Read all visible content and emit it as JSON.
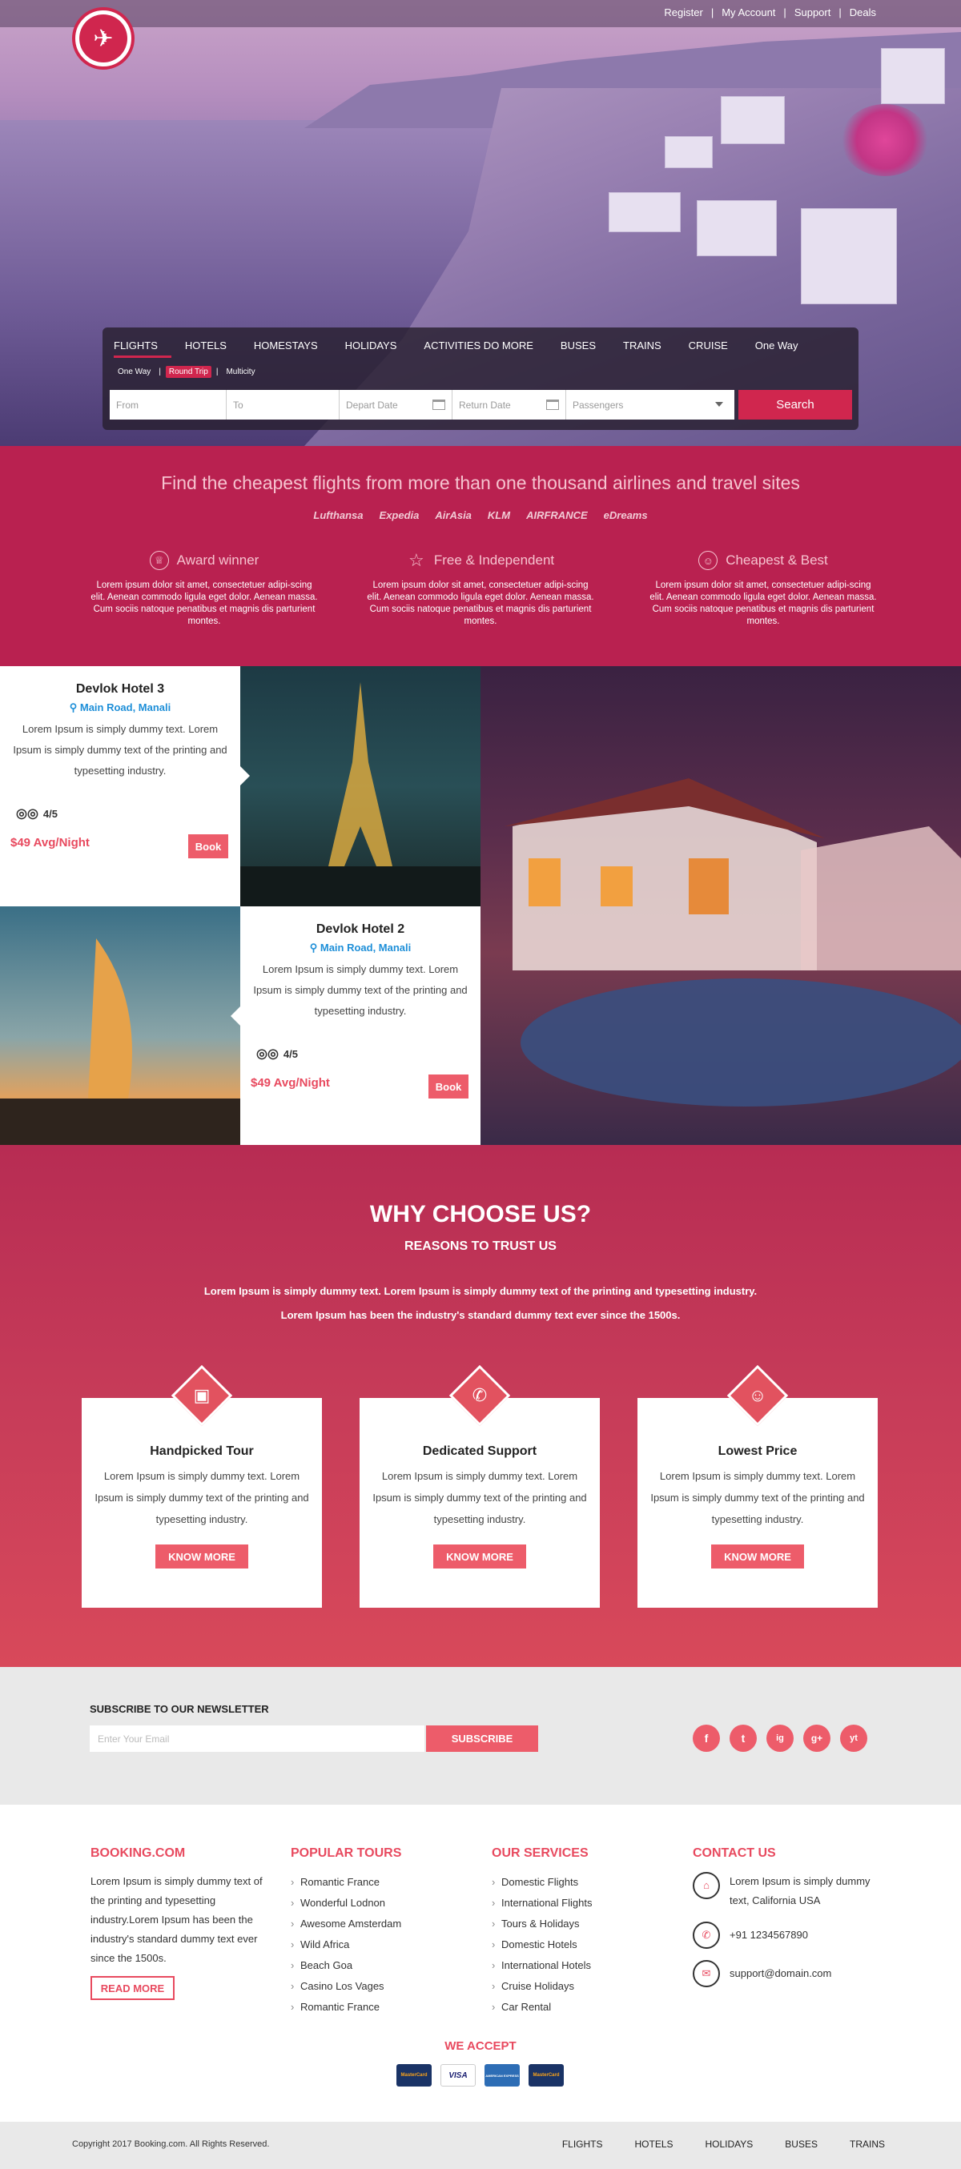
{
  "top_nav": [
    "Register",
    "My Account",
    "Support",
    "Deals"
  ],
  "search": {
    "tabs": [
      "FLIGHTS",
      "HOTELS",
      "HOMESTAYS",
      "HOLIDAYS",
      "ACTIVITIES DO MORE",
      "BUSES",
      "TRAINS",
      "CRUISE",
      "One Way"
    ],
    "trip_types": [
      "One Way",
      "Round Trip",
      "Multicity"
    ],
    "from_placeholder": "From",
    "to_placeholder": "To",
    "depart_placeholder": "Depart Date",
    "return_placeholder": "Return Date",
    "passengers_placeholder": "Passengers",
    "search_label": "Search"
  },
  "intro": {
    "title": "Find the cheapest flights from more than one thousand airlines and travel sites",
    "airlines": [
      "Lufthansa",
      "Expedia",
      "AirAsia",
      "KLM",
      "AIRFRANCE",
      "eDreams"
    ],
    "features": [
      {
        "title": "Award winner",
        "icon": "award-icon",
        "text": "Lorem ipsum dolor sit amet, consectetuer adipi-scing elit. Aenean commodo ligula eget dolor. Aenean massa. Cum sociis natoque penatibus et magnis dis parturient montes."
      },
      {
        "title": "Free & Independent",
        "icon": "star-icon",
        "text": "Lorem ipsum dolor sit amet, consectetuer adipi-scing elit. Aenean commodo ligula eget dolor. Aenean massa. Cum sociis natoque penatibus et magnis dis parturient montes."
      },
      {
        "title": "Cheapest & Best",
        "icon": "smile-icon",
        "text": "Lorem ipsum dolor sit amet, consectetuer adipi-scing elit. Aenean commodo ligula eget dolor. Aenean massa. Cum sociis natoque penatibus et magnis dis parturient montes."
      }
    ]
  },
  "hotels": [
    {
      "name": "Devlok Hotel 3",
      "location": "Main Road, Manali",
      "desc": "Lorem Ipsum is simply dummy text. Lorem Ipsum is simply dummy text of the printing and typesetting industry.",
      "rating": "4/5",
      "price": "$49 Avg/Night",
      "book": "Book"
    },
    {
      "name": "Devlok Hotel 2",
      "location": "Main Road, Manali",
      "desc": "Lorem Ipsum is simply dummy text. Lorem Ipsum is simply dummy text of the printing and typesetting industry.",
      "rating": "4/5",
      "price": "$49 Avg/Night",
      "book": "Book"
    }
  ],
  "why": {
    "title": "WHY CHOOSE US?",
    "subtitle": "REASONS TO TRUST US",
    "line1": "Lorem Ipsum is simply dummy text. Lorem Ipsum is simply dummy text of the printing and typesetting industry.",
    "line2": "Lorem Ipsum has been the industry's standard dummy text ever since the 1500s.",
    "cards": [
      {
        "title": "Handpicked Tour",
        "text": "Lorem Ipsum is simply dummy text. Lorem Ipsum is simply dummy text of the printing and typesetting industry.",
        "button": "KNOW MORE",
        "icon": "briefcase-icon"
      },
      {
        "title": "Dedicated Support",
        "text": "Lorem Ipsum is simply dummy text. Lorem Ipsum is simply dummy text of the printing and typesetting industry.",
        "button": "KNOW MORE",
        "icon": "phone-icon"
      },
      {
        "title": "Lowest Price",
        "text": "Lorem Ipsum is simply dummy text. Lorem Ipsum is simply dummy text of the printing and typesetting industry.",
        "button": "KNOW MORE",
        "icon": "smile-icon"
      }
    ]
  },
  "newsletter": {
    "title": "SUBSCRIBE TO OUR NEWSLETTER",
    "placeholder": "Enter Your Email",
    "button": "SUBSCRIBE"
  },
  "social": [
    "f",
    "t",
    "ig",
    "g+",
    "yt"
  ],
  "footer": {
    "about": {
      "title": "BOOKING.COM",
      "text": "Lorem Ipsum is simply dummy text of the printing and typesetting industry.Lorem Ipsum has been the industry's standard dummy text ever since the 1500s.",
      "button": "READ MORE"
    },
    "tours": {
      "title": "POPULAR TOURS",
      "items": [
        "Romantic France",
        "Wonderful Lodnon",
        "Awesome Amsterdam",
        "Wild Africa",
        "Beach Goa",
        "Casino Los Vages",
        "Romantic France"
      ]
    },
    "services": {
      "title": "OUR SERVICES",
      "items": [
        "Domestic Flights",
        "International Flights",
        "Tours & Holidays",
        "Domestic Hotels",
        "International Hotels",
        "Cruise Holidays",
        "Car Rental"
      ]
    },
    "contact": {
      "title": "CONTACT US",
      "address": "Lorem Ipsum is simply dummy text, California USA",
      "phone": "+91 1234567890",
      "email": "support@domain.com"
    },
    "accept": "WE ACCEPT",
    "cards": [
      "MasterCard",
      "VISA",
      "AMERICAN EXPRESS",
      "MasterCard"
    ],
    "copyright": "Copyright 2017 Booking.com. All Rights Reserved.",
    "bottom_nav": [
      "FLIGHTS",
      "HOTELS",
      "HOLIDAYS",
      "BUSES",
      "TRAINS"
    ]
  },
  "colors": {
    "brand": "#d0264e",
    "accent": "#ed5c6a",
    "band": "#b92150"
  }
}
